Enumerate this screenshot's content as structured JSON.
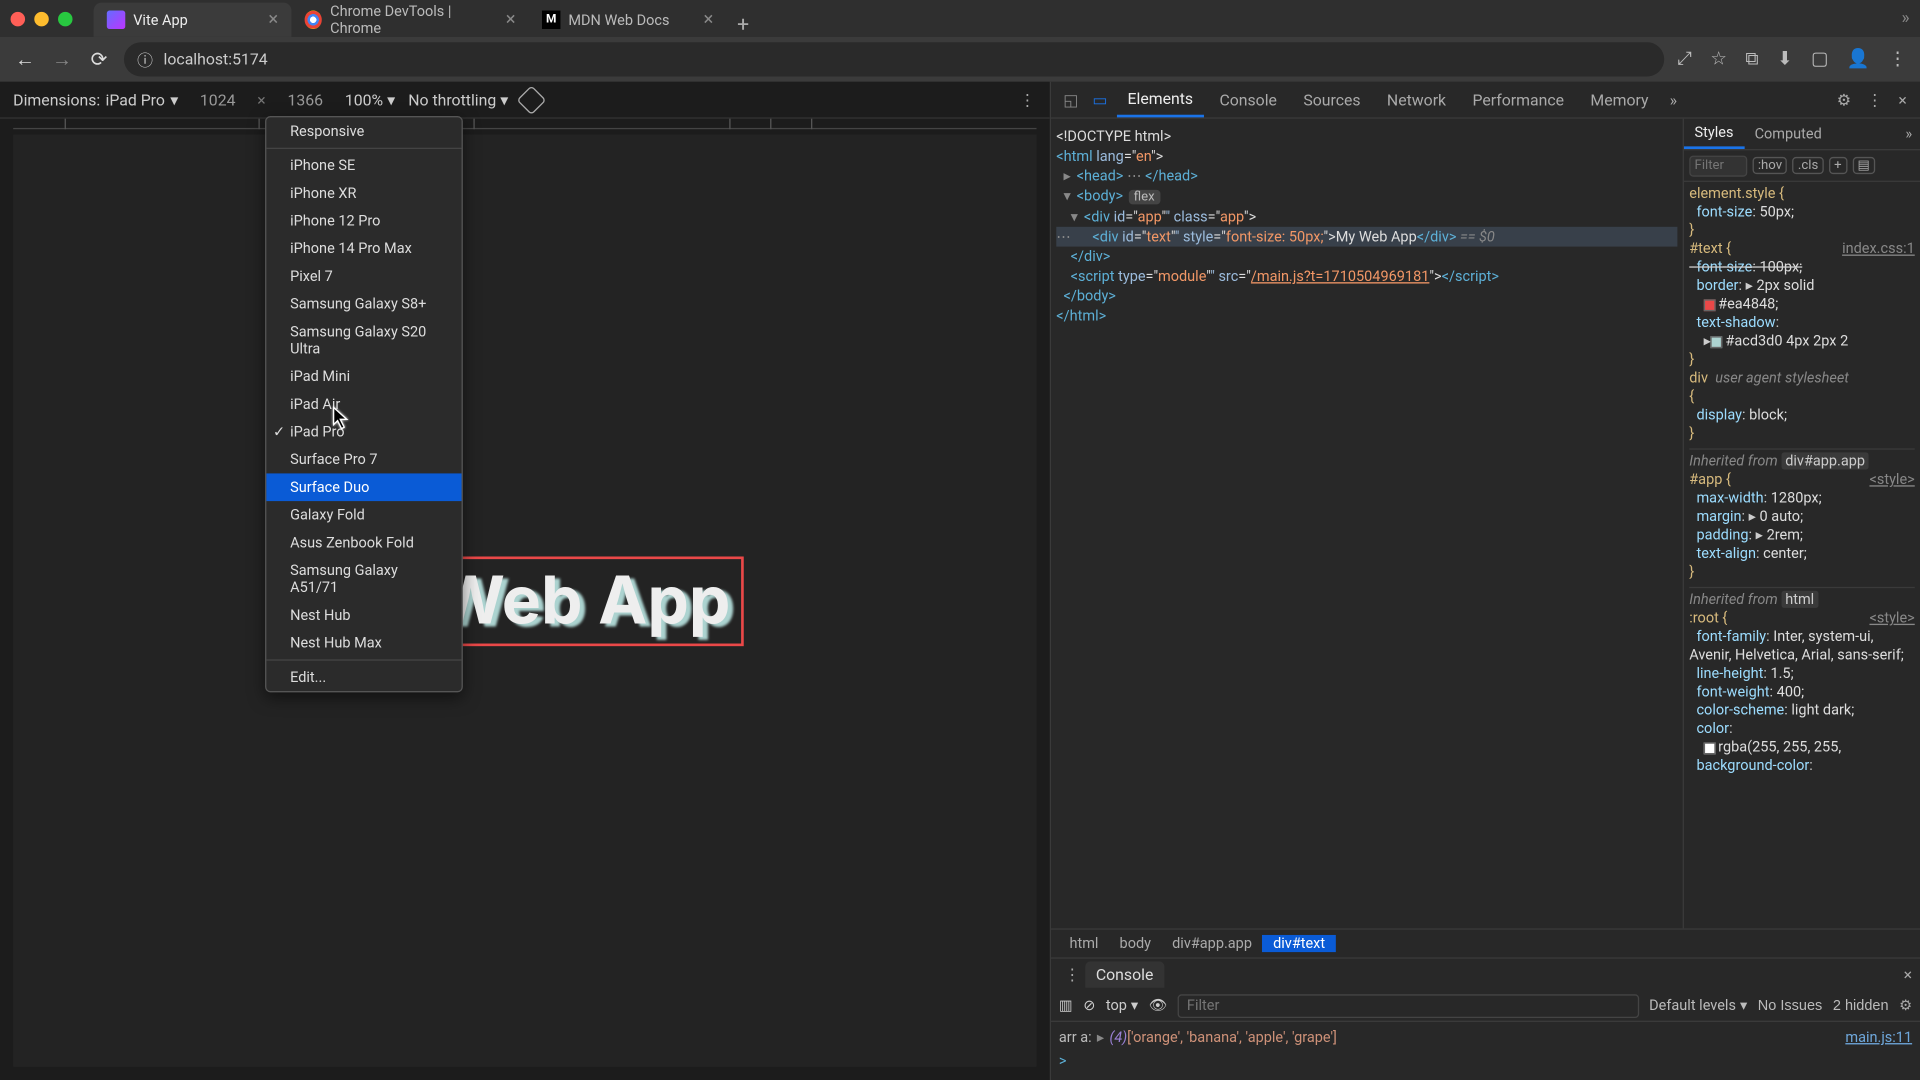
{
  "browser": {
    "tabs": [
      {
        "title": "Vite App",
        "favicon": "vite"
      },
      {
        "title": "Chrome DevTools | Chrome",
        "favicon": "chrome"
      },
      {
        "title": "MDN Web Docs",
        "favicon": "mdn"
      }
    ],
    "new_tab": "+",
    "nav": {
      "back": "←",
      "forward": "→",
      "reload": "⟳"
    },
    "url_icon": "ⓘ",
    "url": "localhost:5174",
    "addr_icons": [
      "⤢",
      "☆",
      "⧉",
      "⬇",
      "▢",
      "👤"
    ],
    "overflow": "⋮"
  },
  "device_toolbar": {
    "dimensions_label": "Dimensions:",
    "selected": "iPad Pro",
    "width": "1024",
    "x": "×",
    "height": "1366",
    "zoom": "100%",
    "throttle": "No throttling",
    "menu": {
      "top": "Responsive",
      "items": [
        "iPhone SE",
        "iPhone XR",
        "iPhone 12 Pro",
        "iPhone 14 Pro Max",
        "Pixel 7",
        "Samsung Galaxy S8+",
        "Samsung Galaxy S20 Ultra",
        "iPad Mini",
        "iPad Air",
        "iPad Pro",
        "Surface Pro 7",
        "Surface Duo",
        "Galaxy Fold",
        "Asus Zenbook Fold",
        "Samsung Galaxy A51/71",
        "Nest Hub",
        "Nest Hub Max"
      ],
      "checked": "iPad Pro",
      "highlighted": "Surface Duo",
      "edit": "Edit..."
    }
  },
  "preview": {
    "text": "My Web App"
  },
  "devtools": {
    "tabs": [
      "Elements",
      "Console",
      "Sources",
      "Network",
      "Performance",
      "Memory"
    ],
    "active": "Elements",
    "dom": {
      "l0": "<!DOCTYPE html>",
      "l1a": "<",
      "l1b": "html",
      "l1c": " lang",
      "l1d": "=\"",
      "l1e": "en",
      "l1f": "\">",
      "l2": "<head>",
      "l2e": "</head>",
      "l3": "<body>",
      "l3flex": "flex",
      "l4a": "<",
      "l4b": "div",
      "l4c": " id",
      "l4d": "=\"",
      "l4e": "app",
      "l4f": "\" class",
      "l4g": "=\"",
      "l4h": "app",
      "l4i": "\">",
      "l5a": "<",
      "l5b": "div",
      "l5c": " id",
      "l5d": "=\"",
      "l5e": "text",
      "l5f": "\" style",
      "l5g": "=\"",
      "l5h": "font-size: 50px;",
      "l5i": "\">",
      "l5txt": "My Web App",
      "l5j": "</",
      "l5k": "div",
      "l5l": ">",
      "l5eq": " == $0",
      "l6": "</div>",
      "l7a": "<",
      "l7b": "script",
      "l7c": " type",
      "l7d": "=\"",
      "l7e": "module",
      "l7f": "\" src",
      "l7g": "=\"",
      "l7h": "/main.js?t=1710504969181",
      "l7i": "\">",
      "l7j": "</",
      "l7k": "script",
      "l7l": ">",
      "l8": "</body>",
      "l9": "</html>"
    },
    "breadcrumb": [
      "html",
      "body",
      "div#app.app",
      "div#text"
    ],
    "styles": {
      "tabs": [
        "Styles",
        "Computed"
      ],
      "filter_ph": "Filter",
      "hov": ":hov",
      "cls": ".cls",
      "plus": "+",
      "r1": {
        "sel": "element.style {",
        "p1": "font-size",
        "v1": "50px;",
        "close": "}"
      },
      "r2": {
        "sel": "#text {",
        "src": "index.css:1",
        "p1": "font-size",
        "v1": "100px;",
        "p2": "border",
        "v2": "2px solid",
        "sw2": "#ea4848",
        "swv2": "#ea4848;",
        "p3": "text-shadow",
        "sw3": "#acd3d0",
        "v3": "#acd3d0 4px 2px 2",
        "close": "}"
      },
      "r3": {
        "sel": "div",
        "note": "user agent stylesheet",
        "open": "{",
        "p1": "display",
        "v1": "block;",
        "close": "}"
      },
      "inh1": "Inherited from ",
      "inh1chip": "div#app.app",
      "r4": {
        "sel": "#app {",
        "src": "<style>",
        "p1": "max-width",
        "v1": "1280px;",
        "p2": "margin",
        "v2": "0 auto;",
        "p3": "padding",
        "v3": "2rem;",
        "p4": "text-align",
        "v4": "center;",
        "close": "}"
      },
      "inh2": "Inherited from ",
      "inh2chip": "html",
      "r5": {
        "sel": ":root {",
        "src": "<style>",
        "p1": "font-family",
        "v1": "Inter, system-ui, Avenir, Helvetica, Arial, sans-serif;",
        "p2": "line-height",
        "v2": "1.5;",
        "p3": "font-weight",
        "v3": "400;",
        "p4": "color-scheme",
        "v4": "light dark;",
        "p5": "color",
        "sw5": "rgba(255,255,255,1)",
        "v5": "rgba(255, 255, 255,",
        "p6": "background-color",
        "close": ""
      }
    },
    "console": {
      "tab": "Console",
      "ctx": "top",
      "filter_ph": "Filter",
      "levels": "Default levels",
      "issues": "No Issues",
      "hidden": "2 hidden",
      "msg_pre": "arr a: ",
      "len": "(4)",
      "arr": " ['orange', 'banana', 'apple', 'grape']",
      "src": "main.js:11",
      "prompt": ">"
    }
  }
}
